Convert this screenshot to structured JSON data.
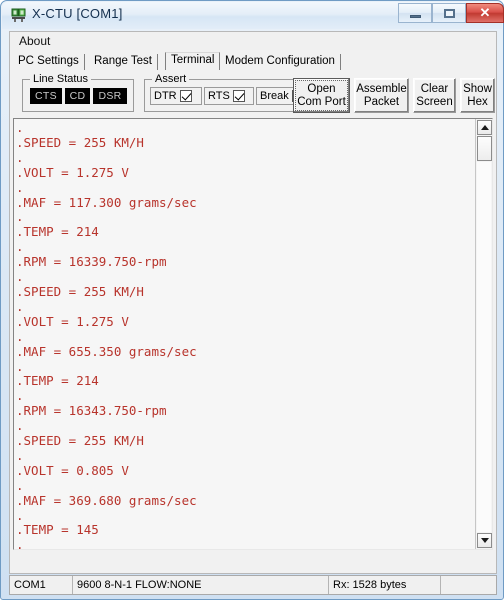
{
  "window": {
    "title": "X-CTU  [COM1]",
    "icon": "chip-icon",
    "controls": {
      "minimize": "minimize-icon",
      "maximize": "maximize-icon",
      "close": "✕"
    }
  },
  "menu": {
    "items": [
      {
        "label": "About",
        "name": "menu-item-about"
      }
    ]
  },
  "tabs": [
    {
      "label": "PC Settings",
      "name": "tab-pc-settings",
      "active": false
    },
    {
      "label": "Range Test",
      "name": "tab-range-test",
      "active": false
    },
    {
      "label": "Terminal",
      "name": "tab-terminal",
      "active": true
    },
    {
      "label": "Modem Configuration",
      "name": "tab-modem-configuration",
      "active": false
    }
  ],
  "line_status": {
    "title": "Line Status",
    "indicators": [
      {
        "label": "CTS",
        "active": false
      },
      {
        "label": "CD",
        "active": false
      },
      {
        "label": "DSR",
        "active": false
      }
    ]
  },
  "assert": {
    "title": "Assert",
    "items": [
      {
        "label": "DTR",
        "checked": true
      },
      {
        "label": "RTS",
        "checked": true
      },
      {
        "label": "Break",
        "checked": false
      }
    ]
  },
  "toolbar": {
    "open_com_port": "Open\nCom Port",
    "open_com_port_line1": "Open",
    "open_com_port_line2": "Com Port",
    "assemble_packet_line1": "Assemble",
    "assemble_packet_line2": "Packet",
    "clear_screen_line1": "Clear",
    "clear_screen_line2": "Screen",
    "show_hex_line1": "Show",
    "show_hex_line2": "Hex"
  },
  "terminal": {
    "text_color": "#b8342c",
    "background": "#f6f6f6",
    "lines": [
      ".",
      ".SPEED = 255 KM/H",
      ".",
      ".VOLT = 1.275 V",
      ".",
      ".MAF = 117.300 grams/sec",
      ".",
      ".TEMP = 214",
      ".",
      ".RPM = 16339.750-rpm",
      ".",
      ".SPEED = 255 KM/H",
      ".",
      ".VOLT = 1.275 V",
      ".",
      ".MAF = 655.350 grams/sec",
      ".",
      ".TEMP = 214",
      ".",
      ".RPM = 16343.750-rpm",
      ".",
      ".SPEED = 255 KM/H",
      ".",
      ".VOLT = 0.805 V",
      ".",
      ".MAF = 369.680 grams/sec",
      ".",
      ".TEMP = 145",
      ".",
      "."
    ],
    "content": ".\n.SPEED = 255 KM/H\n.\n.VOLT = 1.275 V\n.\n.MAF = 117.300 grams/sec\n.\n.TEMP = 214\n.\n.RPM = 16339.750-rpm\n.\n.SPEED = 255 KM/H\n.\n.VOLT = 1.275 V\n.\n.MAF = 655.350 grams/sec\n.\n.TEMP = 214\n.\n.RPM = 16343.750-rpm\n.\n.SPEED = 255 KM/H\n.\n.VOLT = 0.805 V\n.\n.MAF = 369.680 grams/sec\n.\n.TEMP = 145\n.\n."
  },
  "scrollbar": {
    "up_arrow": "scroll-up-icon",
    "down_arrow": "scroll-down-icon"
  },
  "status_bar": {
    "port": "COM1",
    "config": "9600 8-N-1  FLOW:NONE",
    "rx": "Rx: 1528 bytes",
    "extra": ""
  },
  "colors": {
    "terminal_text": "#b8342c",
    "close_button": "#c13a31",
    "led_background": "#000000",
    "led_text": "#c8c8c8"
  }
}
